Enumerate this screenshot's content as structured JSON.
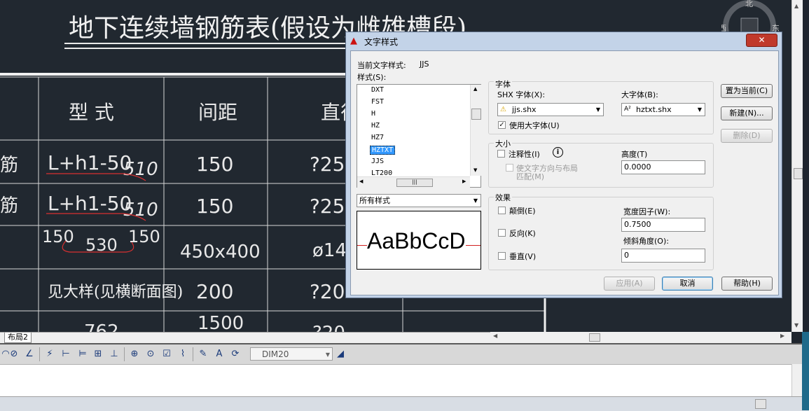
{
  "drawing": {
    "title": "地下连续墙钢筋表(假设为雌雄槽段)",
    "headers": [
      "型 式",
      "间距",
      "直径"
    ],
    "rows": [
      {
        "left": "筋",
        "formula": "L+h1-50",
        "sub": "510",
        "spacing": "150",
        "diameter": "?25"
      },
      {
        "left": "筋",
        "formula": "L+h1-50",
        "sub": "510",
        "spacing": "150",
        "diameter": "?25"
      },
      {
        "left": "",
        "dims": [
          "150",
          "530",
          "150"
        ],
        "spacing": "450x400",
        "diameter": "ø14"
      },
      {
        "left": "",
        "formula": "见大样(见横断面图)",
        "spacing": "200",
        "diameter": "?20"
      },
      {
        "left": "",
        "formula": "762",
        "spacing": "1500",
        "diameter": "?20"
      }
    ],
    "compass": {
      "north": "北",
      "west": "西",
      "east": "东"
    }
  },
  "tabs": {
    "layout2": "布局2"
  },
  "toolbar": {
    "dim_style": "DIM20"
  },
  "dialog": {
    "title": "文字样式",
    "close_label": "✕",
    "current_style_label": "当前文字样式:",
    "current_style_value": "JJS",
    "styles_label": "样式(S):",
    "styles": [
      "DXT",
      "FST",
      "H",
      "HZ",
      "HZ7",
      "HZTXT",
      "JJS",
      "LT200"
    ],
    "selected_style": "HZTXT",
    "filter_value": "所有样式",
    "preview_text": "AaBbCcD",
    "font_group": "字体",
    "shx_font_label": "SHX 字体(X):",
    "shx_font_value": "jjs.shx",
    "big_font_label": "大字体(B):",
    "big_font_value": "hztxt.shx",
    "use_big_font_label": "使用大字体(U)",
    "use_big_font_checked": true,
    "size_group": "大小",
    "annotative_label": "注释性(I)",
    "match_layout_label": "使文字方向与布局",
    "match_layout_label2": "匹配(M)",
    "height_label": "高度(T)",
    "height_value": "0.0000",
    "effects_group": "效果",
    "upside_down_label": "颠倒(E)",
    "backwards_label": "反向(K)",
    "vertical_label": "垂直(V)",
    "width_factor_label": "宽度因子(W):",
    "width_factor_value": "0.7500",
    "oblique_label": "倾斜角度(O):",
    "oblique_value": "0",
    "set_current_label": "置为当前(C)",
    "new_label": "新建(N)...",
    "delete_label": "删除(D)",
    "apply_label": "应用(A)",
    "cancel_label": "取消",
    "help_label": "帮助(H)"
  }
}
